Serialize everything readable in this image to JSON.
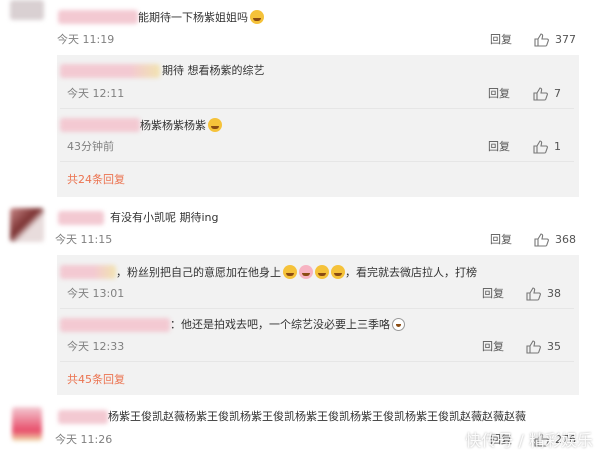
{
  "comments": [
    {
      "text": "能期待一下杨紫姐姐吗",
      "time": "今天 11:19",
      "reply_label": "回复",
      "likes": "377"
    },
    {
      "text": "有没有小凯呢  期待ing",
      "time": "今天 11:15",
      "reply_label": "回复",
      "likes": "368"
    },
    {
      "text": "杨紫王俊凯赵薇杨紫王俊凯杨紫王俊凯杨紫王俊凯杨紫王俊凯杨紫王俊凯赵薇赵薇赵薇",
      "time": "今天 11:26",
      "reply_label": "回复",
      "likes": "276"
    }
  ],
  "replies_group1": [
    {
      "text": "期待 想看杨紫的综艺",
      "time": "今天 12:11",
      "reply_label": "回复",
      "likes": "7"
    },
    {
      "text": "杨紫杨紫杨紫",
      "time": "43分钟前",
      "reply_label": "回复",
      "likes": "1"
    }
  ],
  "replies_group1_more": "共24条回复",
  "replies_group2": [
    {
      "text_a": "，粉丝别把自己的意愿加在他身上",
      "text_b": "，看完就去微店拉人，打榜",
      "time": "今天 13:01",
      "reply_label": "回复",
      "likes": "38"
    },
    {
      "text": "：他还是拍戏去吧，一个综艺没必要上三季咯",
      "time": "今天 12:33",
      "reply_label": "回复",
      "likes": "35"
    }
  ],
  "replies_group2_more": "共45条回复",
  "watermark": "快传号 / 精彩娱乐",
  "icons": {
    "like": "thumb-up-icon",
    "emoji": "laughing-emoji-icon"
  },
  "colors": {
    "more_link": "#eb7350",
    "reply_bg": "#f2f2f2",
    "text": "#333333",
    "meta": "#808080"
  }
}
